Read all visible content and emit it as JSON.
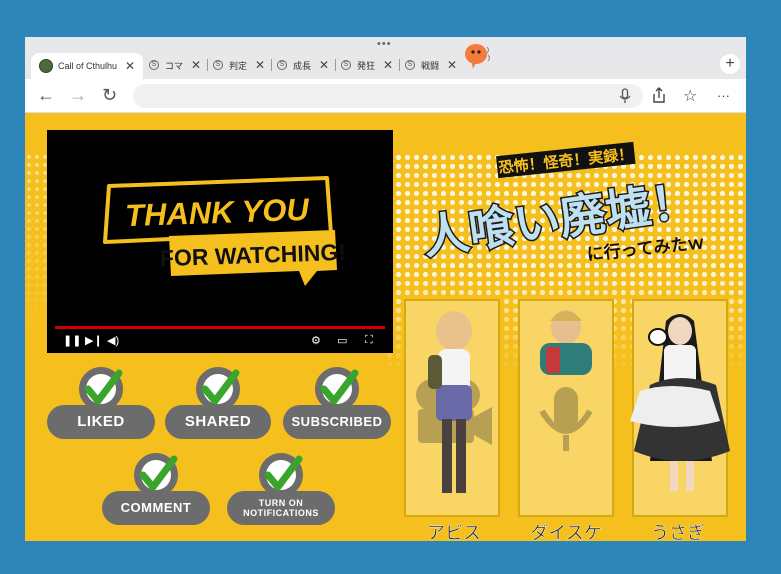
{
  "browser": {
    "active_tab": "Call of Cthulhu",
    "tabs": [
      {
        "label": "コマ"
      },
      {
        "label": "判定"
      },
      {
        "label": "成長"
      },
      {
        "label": "発狂"
      },
      {
        "label": "戦闘"
      }
    ],
    "new_tab_label": "+",
    "more_label": "···",
    "tab_strip_dots": "•••"
  },
  "video": {
    "thank_you": "THANK YOU",
    "for_watching": "FOR WATCHING!"
  },
  "badges": {
    "liked": "LIKED",
    "shared": "SHARED",
    "subscribed": "SUBSCRIBED",
    "comment": "COMMENT",
    "notifications_line1": "TURN ON",
    "notifications_line2": "NOTIFICATIONS"
  },
  "title": {
    "tagline": "恐怖！怪奇！実録！",
    "main": "人喰い廃墟！",
    "sub": "に行ってみたｗ"
  },
  "characters": [
    {
      "name": "アビス"
    },
    {
      "name": "ダイスケ"
    },
    {
      "name": "うさぎ"
    }
  ],
  "colors": {
    "background": "#2e86b8",
    "accent_yellow": "#f5c01e",
    "badge_gray": "#6c6c6c",
    "check_green": "#3aa52b"
  }
}
